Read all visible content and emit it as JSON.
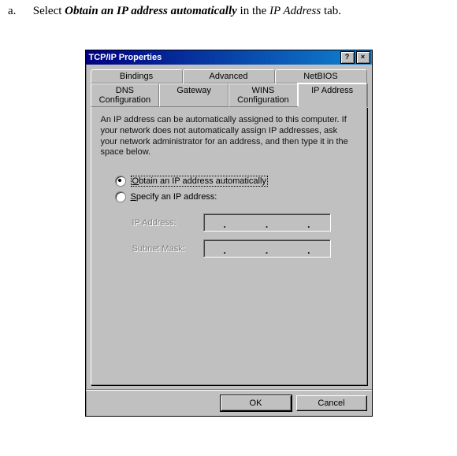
{
  "instruction": {
    "marker": "a.",
    "prefix": "Select ",
    "bold": "Obtain an IP address automatically",
    "mid": " in the ",
    "italic": "IP Address",
    "suffix": " tab."
  },
  "dialog": {
    "title": "TCP/IP Properties",
    "help_glyph": "?",
    "close_glyph": "×",
    "tabs_row1": [
      "Bindings",
      "Advanced",
      "NetBIOS"
    ],
    "tabs_row2": [
      "DNS Configuration",
      "Gateway",
      "WINS Configuration",
      "IP Address"
    ],
    "active_tab": "IP Address",
    "description": "An IP address can be automatically assigned to this computer. If your network does not automatically assign IP addresses, ask your network administrator for an address, and then type it in the space below.",
    "radio1": {
      "u": "O",
      "rest": "btain an IP address automatically",
      "checked": true
    },
    "radio2": {
      "u": "S",
      "rest": "pecify an IP address:",
      "checked": false
    },
    "field1_label": "IP Address:",
    "field2_label": "Subnet Mask:",
    "ip_dot": ".",
    "ok": "OK",
    "cancel": "Cancel"
  }
}
